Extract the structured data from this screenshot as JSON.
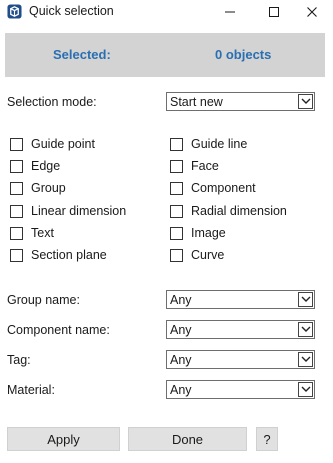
{
  "window": {
    "title": "Quick selection"
  },
  "banner": {
    "selected_label": "Selected:",
    "selected_value": "0 objects"
  },
  "selection_mode": {
    "label": "Selection mode:",
    "value": "Start new"
  },
  "checkboxes": [
    {
      "label": "Guide point",
      "checked": false
    },
    {
      "label": "Guide line",
      "checked": false
    },
    {
      "label": "Edge",
      "checked": false
    },
    {
      "label": "Face",
      "checked": false
    },
    {
      "label": "Group",
      "checked": false
    },
    {
      "label": "Component",
      "checked": false
    },
    {
      "label": "Linear dimension",
      "checked": false
    },
    {
      "label": "Radial dimension",
      "checked": false
    },
    {
      "label": "Text",
      "checked": false
    },
    {
      "label": "Image",
      "checked": false
    },
    {
      "label": "Section plane",
      "checked": false
    },
    {
      "label": "Curve",
      "checked": false
    }
  ],
  "filters": [
    {
      "label": "Group name:",
      "value": "Any"
    },
    {
      "label": "Component name:",
      "value": "Any"
    },
    {
      "label": "Tag:",
      "value": "Any"
    },
    {
      "label": "Material:",
      "value": "Any"
    }
  ],
  "buttons": {
    "apply": "Apply",
    "done": "Done",
    "help": "?"
  },
  "colors": {
    "accent": "#2a6fb1",
    "banner_bg": "#d3d3d3",
    "button_bg": "#e1e1e1"
  }
}
